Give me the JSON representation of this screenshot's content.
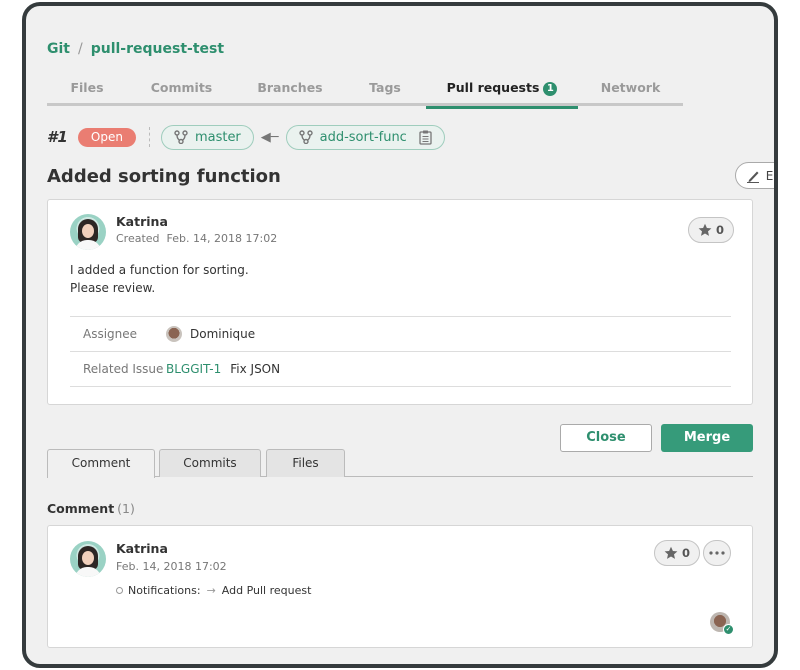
{
  "breadcrumb": {
    "root": "Git",
    "separator": "/",
    "repo": "pull-request-test"
  },
  "nav_tabs": [
    {
      "label": "Files",
      "active": false
    },
    {
      "label": "Commits",
      "active": false
    },
    {
      "label": "Branches",
      "active": false
    },
    {
      "label": "Tags",
      "active": false
    },
    {
      "label": "Pull requests",
      "active": true,
      "badge": "1"
    },
    {
      "label": "Network",
      "active": false
    }
  ],
  "pull_request": {
    "number": "#1",
    "status": "Open",
    "target_branch": "master",
    "source_branch": "add-sort-func",
    "title": "Added sorting function",
    "edit_label": "Edit",
    "author": "Katrina",
    "created_label": "Created",
    "created_at": "Feb. 14, 2018 17:02",
    "body_lines": [
      "I added a function for sorting.",
      "Please review."
    ],
    "stars": "0",
    "assignee_label": "Assignee",
    "assignee": "Dominique",
    "related_issue_label": "Related Issue",
    "related_issue_key": "BLGGIT-1",
    "related_issue_title": "Fix JSON"
  },
  "actions": {
    "close_label": "Close",
    "merge_label": "Merge"
  },
  "sub_tabs": [
    {
      "label": "Comment",
      "active": true
    },
    {
      "label": "Commits",
      "active": false
    },
    {
      "label": "Files",
      "active": false
    }
  ],
  "comments_section": {
    "heading": "Comment",
    "count": "(1)"
  },
  "comment": {
    "author": "Katrina",
    "date": "Feb. 14, 2018 17:02",
    "stars": "0",
    "notification_label": "Notifications:",
    "notification_text": "Add Pull request"
  },
  "colors": {
    "accent": "#2e8f6e",
    "open_status": "#ea7d72",
    "merge_button": "#369b7a",
    "background": "#f0f0f0",
    "frame": "#353b3d"
  }
}
